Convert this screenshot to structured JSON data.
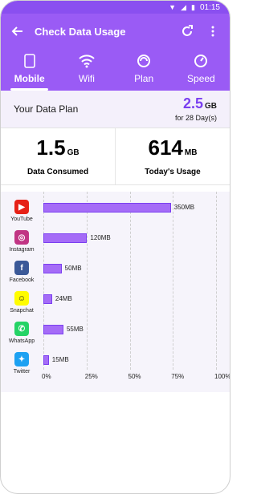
{
  "status_bar": {
    "time": "01:15"
  },
  "appbar": {
    "title": "Check Data Usage"
  },
  "tabs": [
    {
      "label": "Mobile",
      "icon": "phone-icon",
      "active": true
    },
    {
      "label": "Wifi",
      "icon": "wifi-icon",
      "active": false
    },
    {
      "label": "Plan",
      "icon": "plan-icon",
      "active": false
    },
    {
      "label": "Speed",
      "icon": "speedometer-icon",
      "active": false
    }
  ],
  "plan": {
    "label": "Your Data Plan",
    "amount": "2.5",
    "unit": "GB",
    "period": "for 28 Day(s)"
  },
  "stats": [
    {
      "value": "1.5",
      "unit": "GB",
      "label": "Data Consumed"
    },
    {
      "value": "614",
      "unit": "MB",
      "label": "Today's Usage"
    }
  ],
  "chart_data": {
    "type": "bar",
    "categories": [
      "YouTube",
      "Instagram",
      "Facebook",
      "Snapchat",
      "WhatsApp",
      "Twitter"
    ],
    "values": [
      350,
      120,
      50,
      24,
      55,
      15
    ],
    "value_labels": [
      "350MB",
      "120MB",
      "50MB",
      "24MB",
      "55MB",
      "15MB"
    ],
    "x_ticks": [
      "0%",
      "25%",
      "50%",
      "75%",
      "100%"
    ],
    "xlim_mb": [
      0,
      474
    ]
  },
  "colors": {
    "accent": "#9a5bf5",
    "bar": "#a56cf7"
  }
}
